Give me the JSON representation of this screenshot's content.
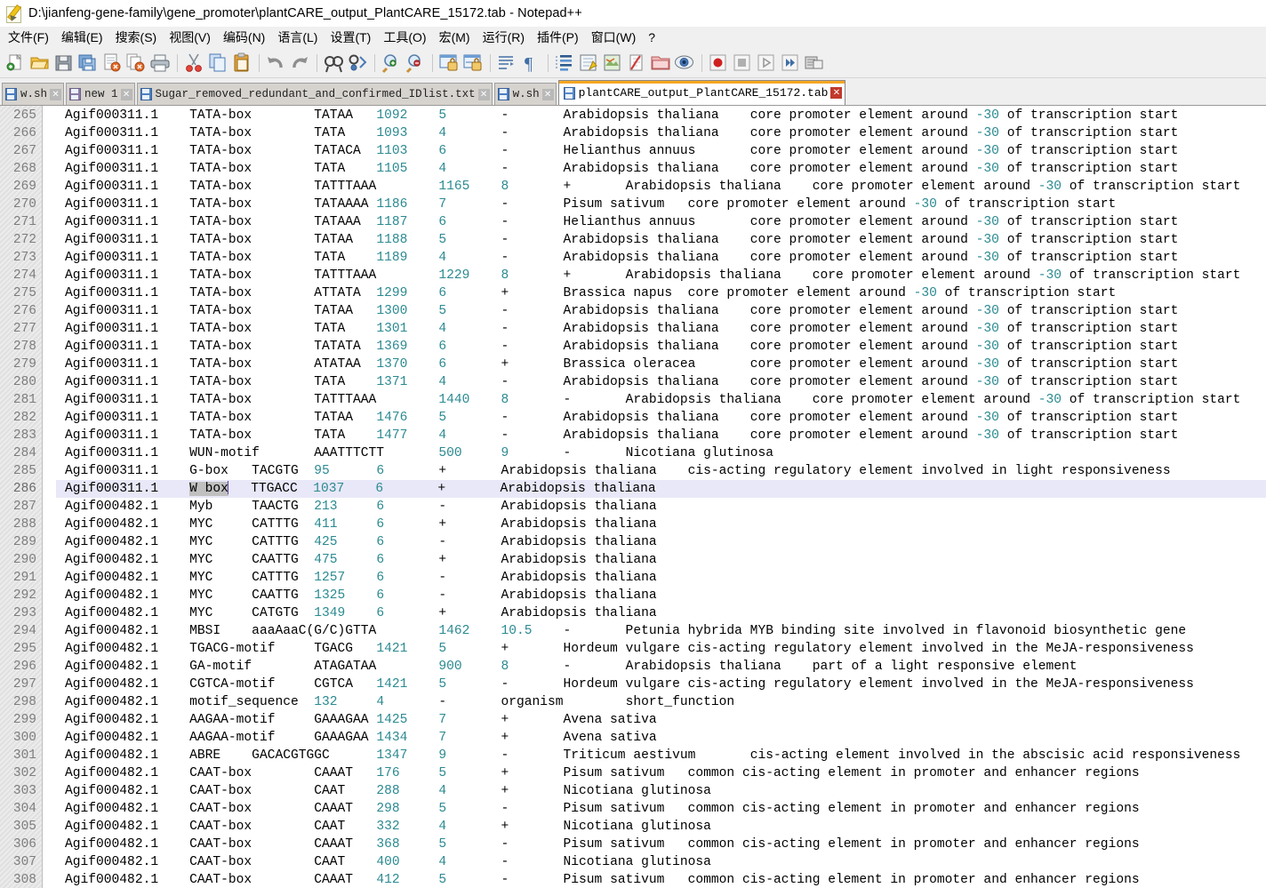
{
  "window": {
    "title": "D:\\jianfeng-gene-family\\gene_promoter\\plantCARE_output_PlantCARE_15172.tab - Notepad++",
    "icon": "notepad-plus-plus-icon"
  },
  "menu": {
    "items": [
      {
        "label": "文件(F)",
        "name": "menu-file"
      },
      {
        "label": "编辑(E)",
        "name": "menu-edit"
      },
      {
        "label": "搜索(S)",
        "name": "menu-search"
      },
      {
        "label": "视图(V)",
        "name": "menu-view"
      },
      {
        "label": "编码(N)",
        "name": "menu-encoding"
      },
      {
        "label": "语言(L)",
        "name": "menu-language"
      },
      {
        "label": "设置(T)",
        "name": "menu-settings"
      },
      {
        "label": "工具(O)",
        "name": "menu-tools"
      },
      {
        "label": "宏(M)",
        "name": "menu-macro"
      },
      {
        "label": "运行(R)",
        "name": "menu-run"
      },
      {
        "label": "插件(P)",
        "name": "menu-plugins"
      },
      {
        "label": "窗口(W)",
        "name": "menu-window"
      },
      {
        "label": "?",
        "name": "menu-help"
      }
    ]
  },
  "toolbar": {
    "buttons": [
      "new-file-icon",
      "open-file-icon",
      "save-icon",
      "save-all-icon",
      "close-file-icon",
      "close-all-icon",
      "print-icon",
      "sep",
      "cut-icon",
      "copy-icon",
      "paste-icon",
      "sep",
      "undo-icon",
      "redo-icon",
      "sep",
      "find-icon",
      "replace-icon",
      "sep",
      "zoom-in-icon",
      "zoom-out-icon",
      "sep",
      "sync-vertical-scroll-icon",
      "sync-horizontal-scroll-icon",
      "sep",
      "word-wrap-icon",
      "show-all-characters-icon",
      "sep",
      "indent-guide-icon",
      "user-defined-language-icon",
      "document-map-icon",
      "function-list-icon",
      "folder-as-workspace-icon",
      "monitoring-icon",
      "sep",
      "record-macro-icon",
      "stop-recording-icon",
      "playback-macro-icon",
      "run-macro-multiple-icon",
      "save-macro-icon"
    ]
  },
  "tabs": [
    {
      "label": "w.sh",
      "name": "tab-w-sh-1",
      "active": false,
      "icon": "saved-document-icon",
      "close": "✕"
    },
    {
      "label": "new 1",
      "name": "tab-new-1",
      "active": false,
      "icon": "unsaved-document-icon",
      "close": "✕"
    },
    {
      "label": "Sugar_removed_redundant_and_confirmed_IDlist.txt",
      "name": "tab-sugar-idlist",
      "active": false,
      "icon": "saved-document-icon",
      "close": "✕"
    },
    {
      "label": "w.sh",
      "name": "tab-w-sh-2",
      "active": false,
      "icon": "saved-document-icon",
      "close": "✕"
    },
    {
      "label": "plantCARE_output_PlantCARE_15172.tab",
      "name": "tab-plantcare-output",
      "active": true,
      "icon": "saved-document-icon",
      "close": "✕"
    }
  ],
  "editor": {
    "current_line_number": 286,
    "selection_text": "W box",
    "accent_current_line": "#e8e8f8",
    "number_color": "#2b8a91",
    "lines": [
      {
        "n": 265,
        "text": "Agif000311.1\tTATA-box\tTATAA\t1092\t5\t-\tArabidopsis thaliana\tcore promoter element around -30 of transcription start"
      },
      {
        "n": 266,
        "text": "Agif000311.1\tTATA-box\tTATA\t1093\t4\t-\tArabidopsis thaliana\tcore promoter element around -30 of transcription start"
      },
      {
        "n": 267,
        "text": "Agif000311.1\tTATA-box\tTATACA\t1103\t6\t-\tHelianthus annuus\tcore promoter element around -30 of transcription start"
      },
      {
        "n": 268,
        "text": "Agif000311.1\tTATA-box\tTATA\t1105\t4\t-\tArabidopsis thaliana\tcore promoter element around -30 of transcription start"
      },
      {
        "n": 269,
        "text": "Agif000311.1\tTATA-box\tTATTTAAA\t1165\t8\t+\tArabidopsis thaliana\tcore promoter element around -30 of transcription start"
      },
      {
        "n": 270,
        "text": "Agif000311.1\tTATA-box\tTATAAAA\t1186\t7\t-\tPisum sativum\tcore promoter element around -30 of transcription start"
      },
      {
        "n": 271,
        "text": "Agif000311.1\tTATA-box\tTATAAA\t1187\t6\t-\tHelianthus annuus\tcore promoter element around -30 of transcription start"
      },
      {
        "n": 272,
        "text": "Agif000311.1\tTATA-box\tTATAA\t1188\t5\t-\tArabidopsis thaliana\tcore promoter element around -30 of transcription start"
      },
      {
        "n": 273,
        "text": "Agif000311.1\tTATA-box\tTATA\t1189\t4\t-\tArabidopsis thaliana\tcore promoter element around -30 of transcription start"
      },
      {
        "n": 274,
        "text": "Agif000311.1\tTATA-box\tTATTTAAA\t1229\t8\t+\tArabidopsis thaliana\tcore promoter element around -30 of transcription start"
      },
      {
        "n": 275,
        "text": "Agif000311.1\tTATA-box\tATTATA\t1299\t6\t+\tBrassica napus\tcore promoter element around -30 of transcription start"
      },
      {
        "n": 276,
        "text": "Agif000311.1\tTATA-box\tTATAA\t1300\t5\t-\tArabidopsis thaliana\tcore promoter element around -30 of transcription start"
      },
      {
        "n": 277,
        "text": "Agif000311.1\tTATA-box\tTATA\t1301\t4\t-\tArabidopsis thaliana\tcore promoter element around -30 of transcription start"
      },
      {
        "n": 278,
        "text": "Agif000311.1\tTATA-box\tTATATA\t1369\t6\t-\tArabidopsis thaliana\tcore promoter element around -30 of transcription start"
      },
      {
        "n": 279,
        "text": "Agif000311.1\tTATA-box\tATATAA\t1370\t6\t+\tBrassica oleracea\tcore promoter element around -30 of transcription start"
      },
      {
        "n": 280,
        "text": "Agif000311.1\tTATA-box\tTATA\t1371\t4\t-\tArabidopsis thaliana\tcore promoter element around -30 of transcription start"
      },
      {
        "n": 281,
        "text": "Agif000311.1\tTATA-box\tTATTTAAA\t1440\t8\t-\tArabidopsis thaliana\tcore promoter element around -30 of transcription start"
      },
      {
        "n": 282,
        "text": "Agif000311.1\tTATA-box\tTATAA\t1476\t5\t-\tArabidopsis thaliana\tcore promoter element around -30 of transcription start"
      },
      {
        "n": 283,
        "text": "Agif000311.1\tTATA-box\tTATA\t1477\t4\t-\tArabidopsis thaliana\tcore promoter element around -30 of transcription start"
      },
      {
        "n": 284,
        "text": "Agif000311.1\tWUN-motif\tAAATTTCTT\t500\t9\t-\tNicotiana glutinosa"
      },
      {
        "n": 285,
        "text": "Agif000311.1\tG-box\tTACGTG\t95\t6\t+\tArabidopsis thaliana\tcis-acting regulatory element involved in light responsiveness"
      },
      {
        "n": 286,
        "text": "Agif000311.1\tW box\tTTGACC\t1037\t6\t+\tArabidopsis thaliana",
        "current": true
      },
      {
        "n": 287,
        "text": "Agif000482.1\tMyb\tTAACTG\t213\t6\t-\tArabidopsis thaliana"
      },
      {
        "n": 288,
        "text": "Agif000482.1\tMYC\tCATTTG\t411\t6\t+\tArabidopsis thaliana"
      },
      {
        "n": 289,
        "text": "Agif000482.1\tMYC\tCATTTG\t425\t6\t-\tArabidopsis thaliana"
      },
      {
        "n": 290,
        "text": "Agif000482.1\tMYC\tCAATTG\t475\t6\t+\tArabidopsis thaliana"
      },
      {
        "n": 291,
        "text": "Agif000482.1\tMYC\tCATTTG\t1257\t6\t-\tArabidopsis thaliana"
      },
      {
        "n": 292,
        "text": "Agif000482.1\tMYC\tCAATTG\t1325\t6\t-\tArabidopsis thaliana"
      },
      {
        "n": 293,
        "text": "Agif000482.1\tMYC\tCATGTG\t1349\t6\t+\tArabidopsis thaliana"
      },
      {
        "n": 294,
        "text": "Agif000482.1\tMBSI\taaaAaaC(G/C)GTTA\t1462\t10.5\t-\tPetunia hybrida\tMYB binding site involved in flavonoid biosynthetic gene"
      },
      {
        "n": 295,
        "text": "Agif000482.1\tTGACG-motif\tTGACG\t1421\t5\t+\tHordeum vulgare\tcis-acting regulatory element involved in the MeJA-responsiveness"
      },
      {
        "n": 296,
        "text": "Agif000482.1\tGA-motif\tATAGATAA\t900\t8\t-\tArabidopsis thaliana\tpart of a light responsive element"
      },
      {
        "n": 297,
        "text": "Agif000482.1\tCGTCA-motif\tCGTCA\t1421\t5\t-\tHordeum vulgare\tcis-acting regulatory element involved in the MeJA-responsiveness"
      },
      {
        "n": 298,
        "text": "Agif000482.1\tmotif_sequence\t132\t4\t-\torganism\tshort_function"
      },
      {
        "n": 299,
        "text": "Agif000482.1\tAAGAA-motif\tGAAAGAA\t1425\t7\t+\tAvena sativa"
      },
      {
        "n": 300,
        "text": "Agif000482.1\tAAGAA-motif\tGAAAGAA\t1434\t7\t+\tAvena sativa"
      },
      {
        "n": 301,
        "text": "Agif000482.1\tABRE\tGACACGTGGC\t1347\t9\t-\tTriticum aestivum\tcis-acting element involved in the abscisic acid responsiveness"
      },
      {
        "n": 302,
        "text": "Agif000482.1\tCAAT-box\tCAAAT\t176\t5\t+\tPisum sativum\tcommon cis-acting element in promoter and enhancer regions"
      },
      {
        "n": 303,
        "text": "Agif000482.1\tCAAT-box\tCAAT\t288\t4\t+\tNicotiana glutinosa"
      },
      {
        "n": 304,
        "text": "Agif000482.1\tCAAT-box\tCAAAT\t298\t5\t-\tPisum sativum\tcommon cis-acting element in promoter and enhancer regions"
      },
      {
        "n": 305,
        "text": "Agif000482.1\tCAAT-box\tCAAT\t332\t4\t+\tNicotiana glutinosa"
      },
      {
        "n": 306,
        "text": "Agif000482.1\tCAAT-box\tCAAAT\t368\t5\t-\tPisum sativum\tcommon cis-acting element in promoter and enhancer regions"
      },
      {
        "n": 307,
        "text": "Agif000482.1\tCAAT-box\tCAAT\t400\t4\t-\tNicotiana glutinosa"
      },
      {
        "n": 308,
        "text": "Agif000482.1\tCAAT-box\tCAAAT\t412\t5\t-\tPisum sativum\tcommon cis-acting element in promoter and enhancer regions"
      }
    ]
  }
}
